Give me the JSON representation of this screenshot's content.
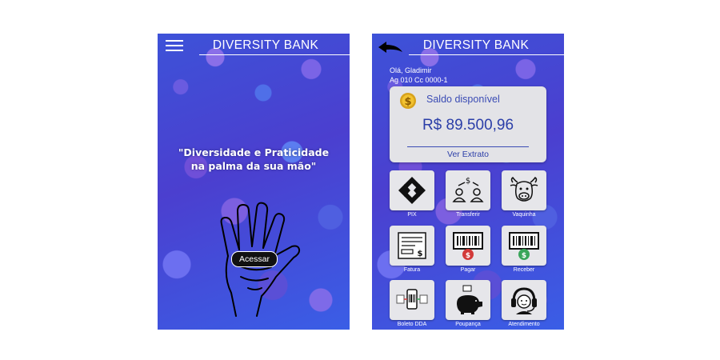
{
  "login": {
    "title": "DIVERSITY BANK",
    "tagline_line1": "\"Diversidade e Praticidade",
    "tagline_line2": "na palma da sua mão\"",
    "access_label": "Acessar"
  },
  "home": {
    "title": "DIVERSITY BANK",
    "greeting": "Olá, Gladimir",
    "account": "Ag 010 Cc 0000-1",
    "balance_label": "Saldo disponível",
    "balance_value": "R$ 89.500,96",
    "statement_label": "Ver Extrato",
    "tiles": [
      {
        "label": "PIX",
        "icon": "pix-icon"
      },
      {
        "label": "Transferir",
        "icon": "transfer-icon"
      },
      {
        "label": "Vaquinha",
        "icon": "cow-icon"
      },
      {
        "label": "Fatura",
        "icon": "invoice-icon"
      },
      {
        "label": "Pagar",
        "icon": "barcode-pay-icon"
      },
      {
        "label": "Receber",
        "icon": "barcode-receive-icon"
      },
      {
        "label": "Boleto DDA",
        "icon": "boleto-dda-icon"
      },
      {
        "label": "Poupança",
        "icon": "piggy-bank-icon"
      },
      {
        "label": "Atendimento",
        "icon": "headset-icon"
      }
    ]
  },
  "colors": {
    "background_blue": "#3d52d8",
    "card_gray": "#e3e3e7",
    "balance_text": "#2b3ea8",
    "pay_red": "#d23a3a",
    "receive_green": "#3aa55a"
  }
}
